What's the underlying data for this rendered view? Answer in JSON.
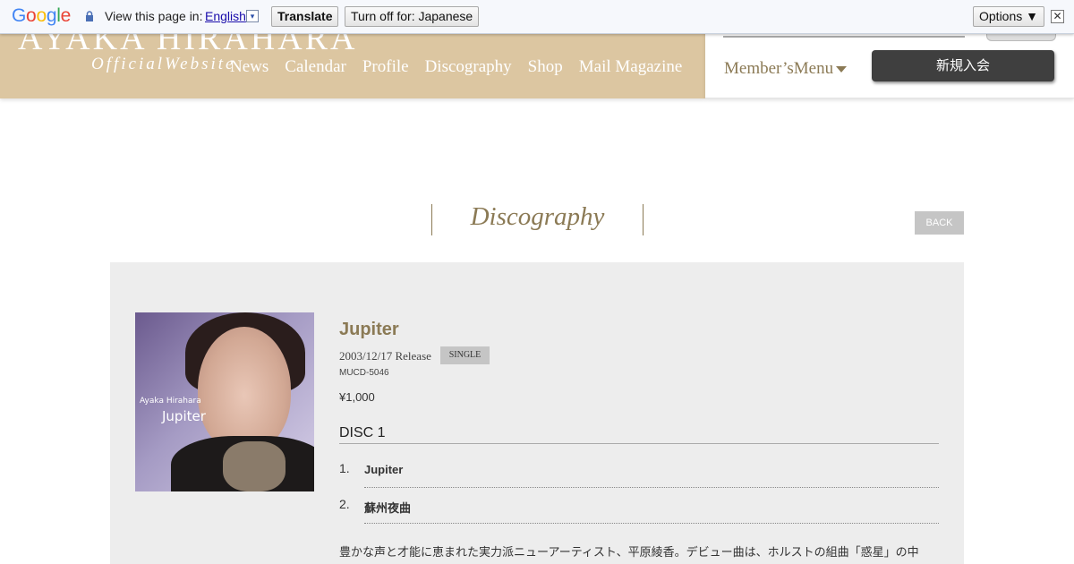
{
  "translate_bar": {
    "logo_letters": [
      {
        "ch": "G",
        "color": "#4285f4"
      },
      {
        "ch": "o",
        "color": "#ea4335"
      },
      {
        "ch": "o",
        "color": "#fbbc05"
      },
      {
        "ch": "g",
        "color": "#4285f4"
      },
      {
        "ch": "l",
        "color": "#34a853"
      },
      {
        "ch": "e",
        "color": "#ea4335"
      }
    ],
    "lock_icon": "lock-icon",
    "view_text": "View this page in:",
    "language": "English",
    "lang_dropdown_glyph": "▾",
    "translate_label": "Translate",
    "turn_off_label": "Turn off for: Japanese",
    "options_label": "Options ▼",
    "close_glyph": "✕"
  },
  "header": {
    "logo": "AYAKA HIRAHARA",
    "logo_sub": "OfficialWebsite",
    "nav": [
      "News",
      "Calendar",
      "Profile",
      "Discography",
      "Shop",
      "Mail Magazine"
    ],
    "member_menu": "Member’sMenu",
    "register_label": "新規入会",
    "brand_color": "#dcc6a1",
    "accent_color": "#8b7a55"
  },
  "page": {
    "heading": "Discography",
    "back_label": "BACK"
  },
  "release": {
    "cover_artist": "Ayaka Hirahara",
    "cover_title": "Jupiter",
    "title": "Jupiter",
    "release_text": "2003/12/17 Release",
    "badge": "SINGLE",
    "catalog_no": "MUCD-5046",
    "price": "¥1,000",
    "disc_label": "DISC 1",
    "tracks": [
      {
        "num": "1.",
        "name": "Jupiter"
      },
      {
        "num": "2.",
        "name": "蘇州夜曲"
      }
    ],
    "description": "豊かな声と才能に恵まれた実力派ニューアーティスト、平原綾香。デビュー曲は、ホルストの組曲「惑星」の中"
  }
}
